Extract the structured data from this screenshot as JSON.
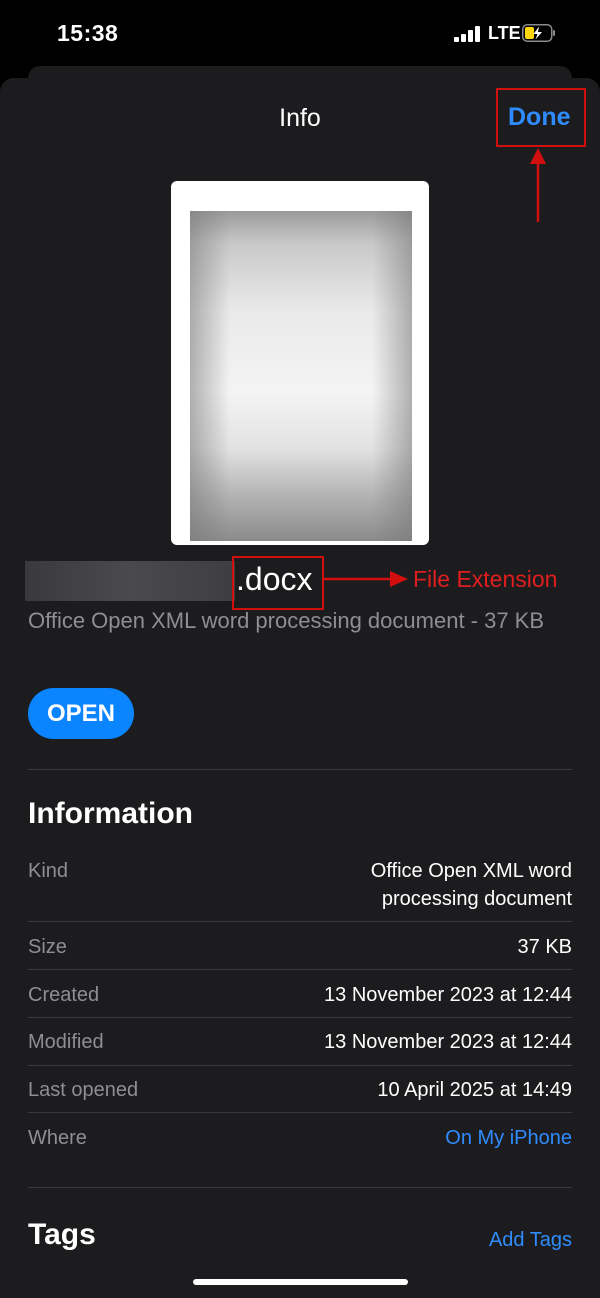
{
  "status_bar": {
    "time": "15:38",
    "network": "LTE"
  },
  "header": {
    "title": "Info",
    "done_label": "Done"
  },
  "file": {
    "extension": ".docx",
    "description": "Office Open XML word processing document - 37 KB",
    "open_label": "OPEN"
  },
  "annotation": {
    "label": "File Extension",
    "color": "#d20f0f"
  },
  "information": {
    "title": "Information",
    "rows": [
      {
        "label": "Kind",
        "value_line1": "Office Open XML word",
        "value_line2": "processing document"
      },
      {
        "label": "Size",
        "value": "37 KB"
      },
      {
        "label": "Created",
        "value": "13 November 2023 at 12:44"
      },
      {
        "label": "Modified",
        "value": "13 November 2023 at 12:44"
      },
      {
        "label": "Last opened",
        "value": "10 April 2025 at 14:49"
      },
      {
        "label": "Where",
        "value": "On My iPhone"
      }
    ]
  },
  "tags": {
    "title": "Tags",
    "add_label": "Add Tags"
  },
  "colors": {
    "accent": "#2f8cff",
    "background": "#1c1c1e",
    "secondary_text": "#8e8e93"
  }
}
